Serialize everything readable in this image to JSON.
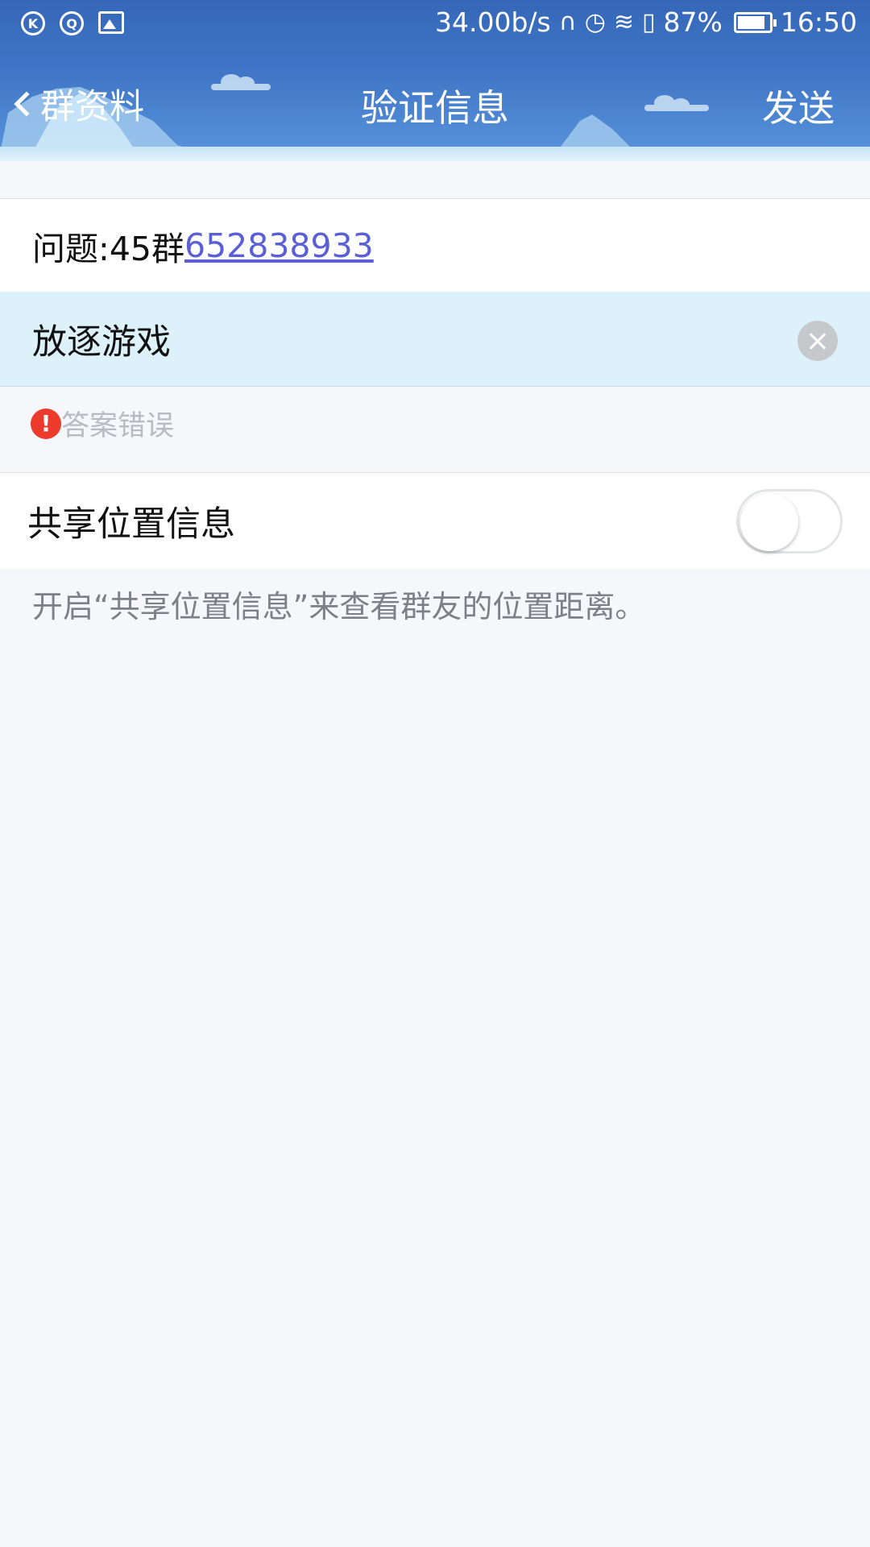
{
  "status_bar": {
    "left_icons": [
      "kugou-icon",
      "qq-icon",
      "gallery-icon"
    ],
    "network_speed": "34.00b/s",
    "battery_percent": "87%",
    "battery_level": 0.87,
    "time": "16:50"
  },
  "title_bar": {
    "back_label": "群资料",
    "title": "验证信息",
    "send_label": "发送"
  },
  "question": {
    "prefix": "问题:45群",
    "link": "652838933"
  },
  "answer": {
    "value": "放逐游戏"
  },
  "error": {
    "icon": "!",
    "message": "答案错误"
  },
  "share_location": {
    "label": "共享位置信息",
    "enabled": false,
    "hint": "开启“共享位置信息”来查看群友的位置距离。"
  },
  "colors": {
    "header": "#3f76c6",
    "link": "#5a5fd6",
    "answer_bg": "#ddf1fb",
    "error": "#ec3a2c",
    "page_bg": "#f5f7fa"
  }
}
